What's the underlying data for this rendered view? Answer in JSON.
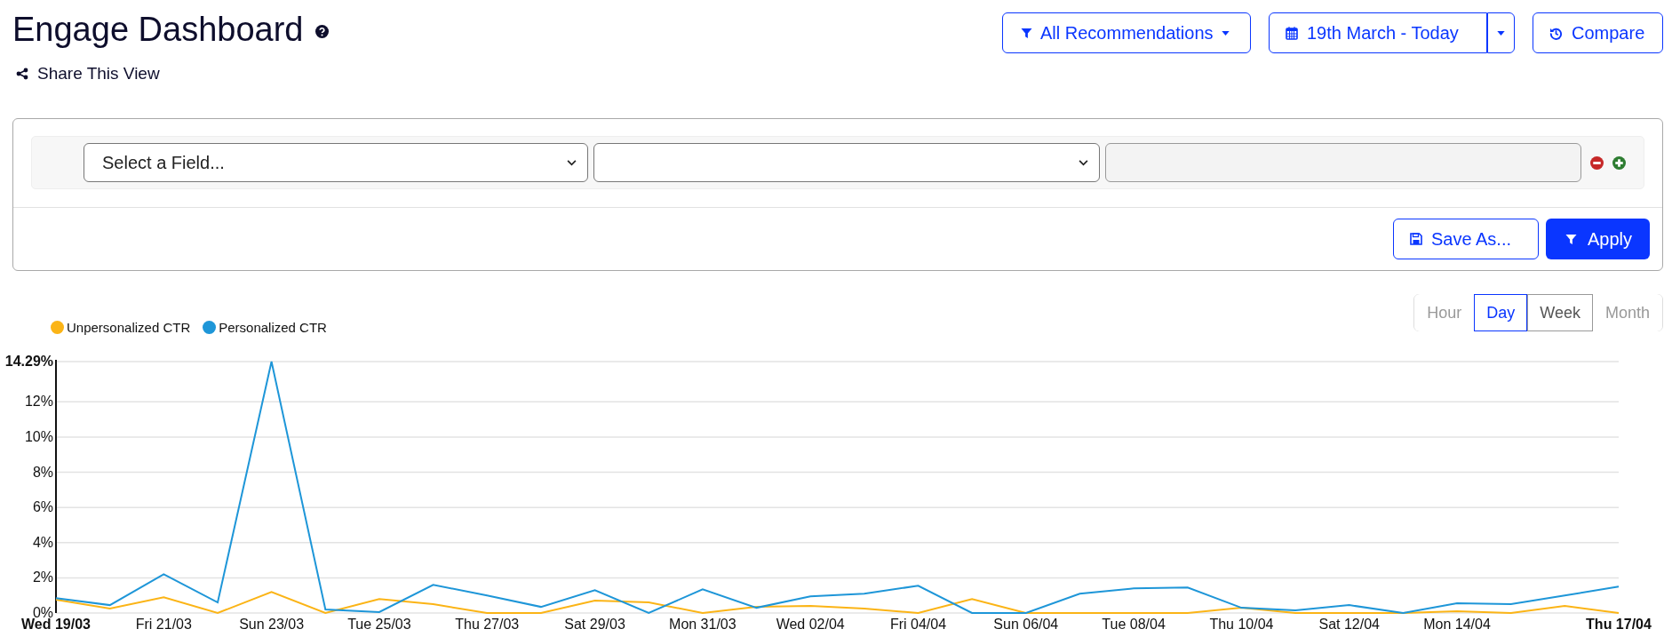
{
  "header": {
    "title": "Engage Dashboard",
    "share_link": "Share This View"
  },
  "toolbar": {
    "recommendations_filter": "All Recommendations",
    "date_range": "19th March - Today",
    "compare": "Compare"
  },
  "filter_panel": {
    "rows": [
      {
        "field": "Select a Field...",
        "value_disabled": true
      }
    ],
    "save_as": "Save As...",
    "apply": "Apply"
  },
  "granularity": [
    {
      "label": "Hour",
      "selected": false,
      "disabled": true
    },
    {
      "label": "Day",
      "selected": true,
      "disabled": false
    },
    {
      "label": "Week",
      "selected": false,
      "disabled": false
    },
    {
      "label": "Month",
      "selected": false,
      "disabled": true
    }
  ],
  "chart": {
    "chart_data": {
      "type": "line",
      "categories": [
        "Wed 19/03",
        null,
        "Fri 21/03",
        null,
        "Sun 23/03",
        null,
        "Tue 25/03",
        null,
        "Thu 27/03",
        null,
        "Sat 29/03",
        null,
        "Mon 31/03",
        null,
        "Wed 02/04",
        null,
        "Fri 04/04",
        null,
        "Sun 06/04",
        null,
        "Tue 08/04",
        null,
        "Thu 10/04",
        null,
        "Sat 12/04",
        null,
        "Mon 14/04",
        null,
        null,
        "Thu 17/04"
      ],
      "series": [
        {
          "name": "Unpersonalized CTR",
          "color": "#fbb416",
          "values": [
            0.75,
            0.25,
            0.9,
            0,
            1.2,
            0,
            0.8,
            0.5,
            0,
            0,
            0.7,
            0.6,
            0,
            0.35,
            0.4,
            0.25,
            0,
            0.8,
            0,
            0,
            0,
            0,
            0.3,
            0,
            0,
            0,
            0.1,
            0,
            0.4,
            0
          ]
        },
        {
          "name": "Personalized CTR",
          "color": "#1e96d8",
          "values": [
            0.85,
            0.45,
            2.2,
            0.6,
            14.29,
            0.2,
            0.05,
            1.6,
            1.0,
            0.35,
            1.3,
            0,
            1.35,
            0.3,
            0.95,
            1.1,
            1.55,
            0,
            0,
            1.1,
            1.4,
            1.45,
            0.3,
            0.15,
            0.45,
            0,
            0.55,
            0.5,
            1.0,
            1.5
          ]
        }
      ],
      "ylim": [
        0,
        14.29
      ],
      "grid": true,
      "yticks": [
        {
          "value": 0,
          "label": "0%"
        },
        {
          "value": 2,
          "label": "2%"
        },
        {
          "value": 4,
          "label": "4%"
        },
        {
          "value": 6,
          "label": "6%"
        },
        {
          "value": 8,
          "label": "8%"
        },
        {
          "value": 10,
          "label": "10%"
        },
        {
          "value": 12,
          "label": "12%"
        },
        {
          "value": 14.29,
          "label": "14.29%"
        }
      ]
    }
  }
}
